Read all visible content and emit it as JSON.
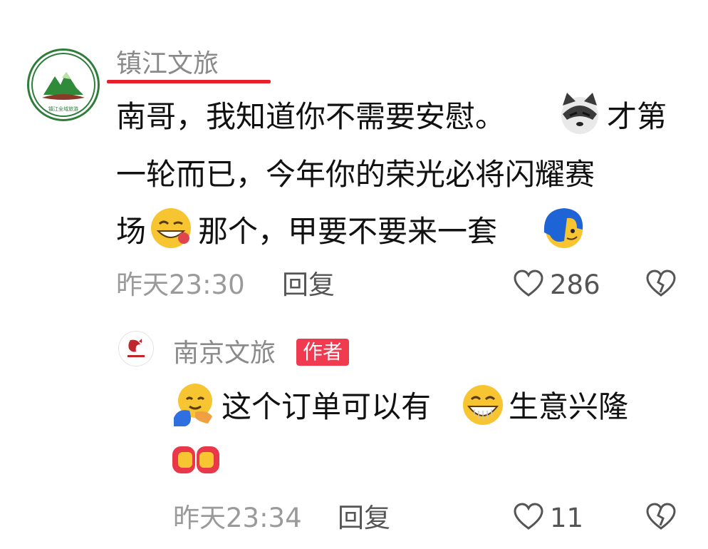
{
  "comment1": {
    "username": "镇江文旅",
    "avatar_text": "ZHENJIANG WHOLE DOMAIN TOURISM",
    "lines": [
      "南哥，我知道你不需要安慰。",
      "才第",
      "一轮而已，今年你的荣光必将闪耀赛",
      "场",
      "那个，甲要不要来一套"
    ],
    "time": "昨天23:30",
    "reply_label": "回复",
    "like_count": "286"
  },
  "comment2": {
    "username": "南京文旅",
    "author_badge": "作者",
    "lines": [
      "这个订单可以有",
      "生意兴隆"
    ],
    "time": "昨天23:34",
    "reply_label": "回复",
    "like_count": "11"
  },
  "colors": {
    "underline": "#e8202a",
    "badge": "#f03a4f",
    "avatar_green": "#2e7d3a",
    "avatar_red": "#c0272d"
  },
  "icons": [
    "wolf-emoji-icon",
    "grin-tongue-emoji-icon",
    "blue-hair-emoji-icon",
    "hug-emoji-icon",
    "big-grin-emoji-icon",
    "fist-bump-emoji-icon",
    "heart-outline-icon",
    "broken-heart-icon"
  ]
}
